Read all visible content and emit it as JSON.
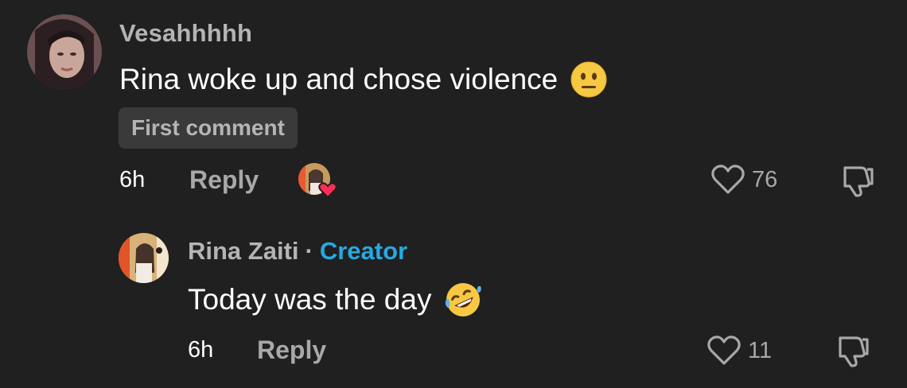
{
  "comment": {
    "username": "Vesahhhhh",
    "text": "Rina woke up and chose violence",
    "emoji": "neutral-face-emoji",
    "badge": "First comment",
    "time": "6h",
    "reply_label": "Reply",
    "likes": "76"
  },
  "reply": {
    "username": "Rina Zaiti",
    "separator": "·",
    "creator_label": "Creator",
    "text": "Today was the day",
    "emoji": "rolling-on-floor-laughing-emoji",
    "time": "6h",
    "reply_label": "Reply",
    "likes": "11"
  },
  "colors": {
    "background": "#202020",
    "creator_accent": "#27a9e1",
    "heart_badge": "#fe2c55"
  }
}
